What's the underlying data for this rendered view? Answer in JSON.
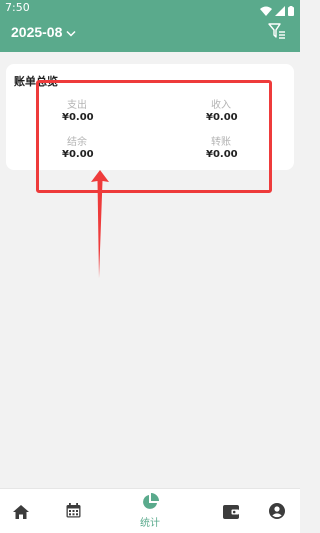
{
  "status_bar": {
    "time": "7:50"
  },
  "header": {
    "period": "2025-08"
  },
  "overview": {
    "title": "账单总览",
    "expense": {
      "label": "支出",
      "value": "¥0.00"
    },
    "income": {
      "label": "收入",
      "value": "¥0.00"
    },
    "balance": {
      "label": "结余",
      "value": "¥0.00"
    },
    "transfer": {
      "label": "转账",
      "value": "¥0.00"
    }
  },
  "bottom_nav": {
    "active": "stats",
    "stats_label": "统计",
    "items": [
      "home-icon",
      "calendar-icon",
      "pie-chart-icon",
      "wallet-icon",
      "profile-icon"
    ]
  },
  "colors": {
    "accent": "#5aaa8c",
    "annotation": "#ee3b3b",
    "icon_inactive": "#3c3c3c"
  }
}
